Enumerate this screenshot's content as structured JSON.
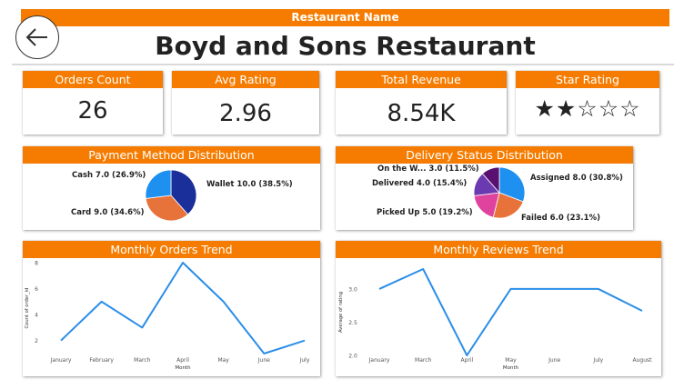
{
  "header": {
    "label": "Restaurant Name",
    "restaurant_name": "Boyd and Sons Restaurant",
    "back_icon": "arrow-left-icon"
  },
  "kpis": {
    "orders": {
      "title": "Orders Count",
      "value": "26"
    },
    "avg_rating": {
      "title": "Avg Rating",
      "value": "2.96"
    },
    "revenue": {
      "title": "Total Revenue",
      "value": "8.54K"
    },
    "stars": {
      "title": "Star Rating",
      "rating": 2,
      "max": 5
    }
  },
  "colors": {
    "accent": "#f57c00",
    "wallet": "#1a2f9a",
    "card": "#e8733a",
    "cash": "#1e90f0",
    "assigned": "#1e90f0",
    "failed": "#e8733a",
    "picked_up": "#e0439d",
    "delivered": "#6b3ab0",
    "on_the_way": "#5a1070",
    "line": "#2b8ee8"
  },
  "payment": {
    "title": "Payment Method Distribution",
    "slices": [
      {
        "name": "Wallet",
        "label": "Wallet 10.0 (38.5%)",
        "value": 10.0
      },
      {
        "name": "Card",
        "label": "Card 9.0 (34.6%)",
        "value": 9.0
      },
      {
        "name": "Cash",
        "label": "Cash 7.0 (26.9%)",
        "value": 7.0
      }
    ]
  },
  "delivery": {
    "title": "Delivery Status Distribution",
    "slices": [
      {
        "name": "Assigned",
        "label": "Assigned 8.0 (30.8%)",
        "value": 8.0
      },
      {
        "name": "Failed",
        "label": "Failed 6.0 (23.1%)",
        "value": 6.0
      },
      {
        "name": "Picked Up",
        "label": "Picked Up 5.0 (19.2%)",
        "value": 5.0
      },
      {
        "name": "Delivered",
        "label": "Delivered 4.0 (15.4%)",
        "value": 4.0
      },
      {
        "name": "On the W...",
        "label": "On the W... 3.0 (11.5%)",
        "value": 3.0
      }
    ]
  },
  "chart_data": [
    {
      "type": "line",
      "title": "Monthly Orders Trend",
      "xlabel": "Month",
      "ylabel": "Count of order_id",
      "categories": [
        "January",
        "February",
        "March",
        "April",
        "May",
        "June",
        "July"
      ],
      "values": [
        2,
        5,
        3,
        8,
        5,
        1,
        2
      ],
      "yticks": [
        2,
        4,
        6,
        8
      ],
      "ylim": [
        1,
        8
      ]
    },
    {
      "type": "line",
      "title": "Monthly Reviews Trend",
      "xlabel": "Month",
      "ylabel": "Average of rating",
      "categories": [
        "January",
        "March",
        "April",
        "May",
        "June",
        "July",
        "August"
      ],
      "values": [
        3.0,
        3.3,
        2.0,
        3.0,
        3.0,
        3.0,
        2.67
      ],
      "yticks": [
        "2.0",
        "2.5",
        "3.0"
      ],
      "ylim": [
        2.0,
        3.3
      ]
    }
  ]
}
